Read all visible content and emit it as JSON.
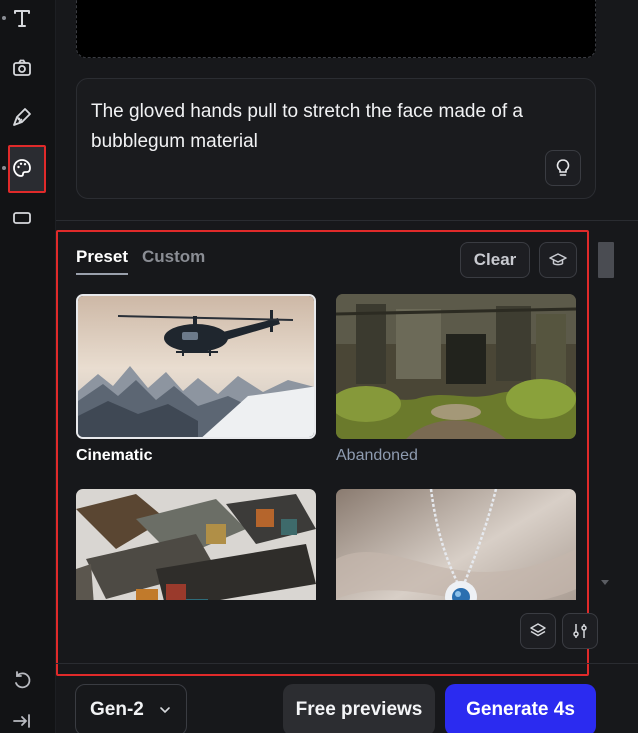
{
  "rail": {
    "items": [
      {
        "icon": "text-icon"
      },
      {
        "icon": "camera-icon"
      },
      {
        "icon": "brush-icon"
      },
      {
        "icon": "palette-icon",
        "active": true
      },
      {
        "icon": "aspect-ratio-icon"
      }
    ],
    "bottom": [
      {
        "icon": "undo-icon"
      },
      {
        "icon": "collapse-panel-icon"
      }
    ]
  },
  "prompt": {
    "text": "The gloved hands pull to stretch the face made of a bubblegum material"
  },
  "styles": {
    "tabs": [
      {
        "label": "Preset",
        "active": true
      },
      {
        "label": "Custom",
        "active": false
      }
    ],
    "clear_label": "Clear",
    "presets": [
      {
        "label": "Cinematic",
        "selected": true
      },
      {
        "label": "Abandoned",
        "selected": false
      },
      {
        "label": "",
        "selected": false
      },
      {
        "label": "",
        "selected": false
      }
    ]
  },
  "footer": {
    "model": "Gen-2",
    "free_previews_label": "Free previews",
    "generate_label": "Generate 4s"
  },
  "colors": {
    "accent_blue": "#2b2bf0",
    "highlight_red": "#e02a2a",
    "background": "#17181b"
  }
}
